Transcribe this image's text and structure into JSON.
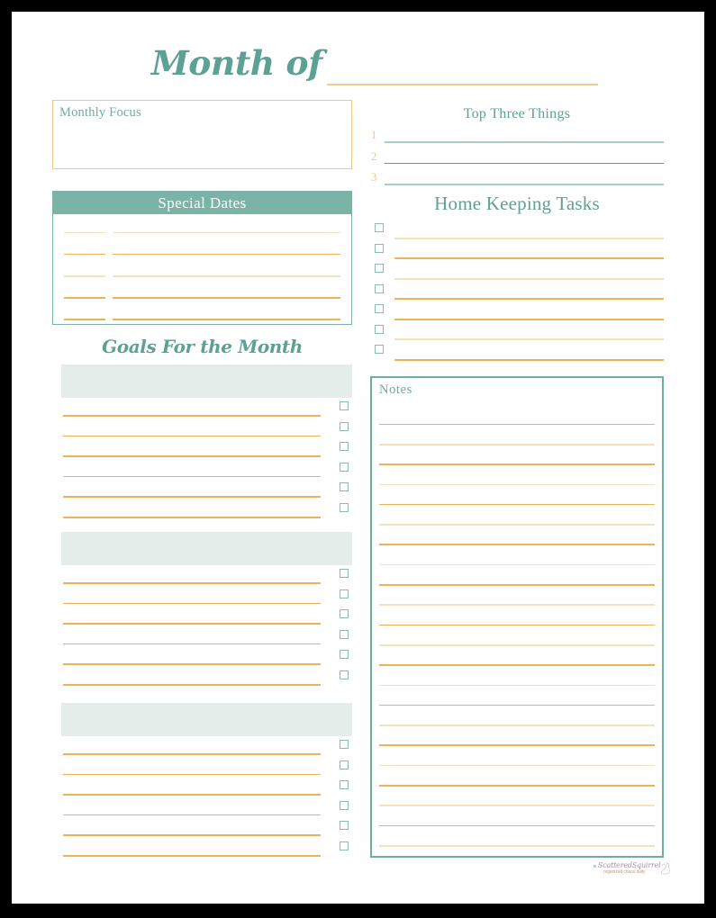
{
  "document": {
    "type": "monthly-planner-printable",
    "paper_background": "#ffffff",
    "frame_background": "#000000"
  },
  "theme": {
    "teal": "#7cb3a7",
    "teal_text": "#5fa095",
    "teal_soft": "#89bcb2",
    "gold_light": "#f7e0bb",
    "gold_dark": "#eeb25c",
    "gold_border": "#eec887",
    "band_gray": "#e5edeb",
    "line_teal_light": "#a8cdc6",
    "line_teal_dark": "#5ea095"
  },
  "masthead": {
    "title": "Month of",
    "rule_color": "#f1cd92"
  },
  "monthly_focus": {
    "label": "Monthly Focus",
    "border_color": "#eec887"
  },
  "top_three": {
    "title": "Top Three Things",
    "rows": [
      {
        "number": "1",
        "line_tone": "light"
      },
      {
        "number": "2",
        "line_tone": "dark"
      },
      {
        "number": "3",
        "line_tone": "light"
      }
    ]
  },
  "special_dates": {
    "title": "Special Dates",
    "header_bg": "#7cb3a7",
    "header_text_color": "#ffffff",
    "rows": [
      {
        "date_tone": "light",
        "text_tone": "light"
      },
      {
        "date_tone": "dark",
        "text_tone": "dark"
      },
      {
        "date_tone": "light",
        "text_tone": "light"
      },
      {
        "date_tone": "dark",
        "text_tone": "dark"
      },
      {
        "date_tone": "dark",
        "text_tone": "dark"
      }
    ]
  },
  "home_keeping": {
    "title": "Home Keeping Tasks",
    "rows": [
      {
        "checkbox": "unchecked",
        "line_tone": "light"
      },
      {
        "checkbox": "unchecked",
        "line_tone": "dark"
      },
      {
        "checkbox": "unchecked",
        "line_tone": "light"
      },
      {
        "checkbox": "unchecked",
        "line_tone": "dark"
      },
      {
        "checkbox": "unchecked",
        "line_tone": "dark"
      },
      {
        "checkbox": "unchecked",
        "line_tone": "light"
      },
      {
        "checkbox": "unchecked",
        "line_tone": "dark"
      }
    ]
  },
  "goals": {
    "title": "Goals For the Month",
    "blocks": [
      {
        "band_label": "",
        "rows": [
          {
            "checkbox": "unchecked",
            "line_tone": "dark"
          },
          {
            "checkbox": "unchecked",
            "line_tone": "dark"
          },
          {
            "checkbox": "unchecked",
            "line_tone": "dark"
          },
          {
            "checkbox": "unchecked",
            "line_tone": "dark"
          },
          {
            "checkbox": "unchecked",
            "line_tone": "dark"
          },
          {
            "checkbox": "unchecked",
            "line_tone": "dark"
          }
        ]
      },
      {
        "band_label": "",
        "rows": [
          {
            "checkbox": "unchecked",
            "line_tone": "dark"
          },
          {
            "checkbox": "unchecked",
            "line_tone": "dark"
          },
          {
            "checkbox": "unchecked",
            "line_tone": "dark"
          },
          {
            "checkbox": "unchecked",
            "line_tone": "dark"
          },
          {
            "checkbox": "unchecked",
            "line_tone": "dark"
          },
          {
            "checkbox": "unchecked",
            "line_tone": "dark"
          }
        ]
      },
      {
        "band_label": "",
        "rows": [
          {
            "checkbox": "unchecked",
            "line_tone": "dark"
          },
          {
            "checkbox": "unchecked",
            "line_tone": "dark"
          },
          {
            "checkbox": "unchecked",
            "line_tone": "dark"
          },
          {
            "checkbox": "unchecked",
            "line_tone": "dark"
          },
          {
            "checkbox": "unchecked",
            "line_tone": "dark"
          },
          {
            "checkbox": "unchecked",
            "line_tone": "dark"
          }
        ]
      }
    ]
  },
  "notes": {
    "label": "Notes",
    "border_color": "#6fae9f",
    "rows": [
      {
        "line_tone": "dark"
      },
      {
        "line_tone": "light"
      },
      {
        "line_tone": "dark"
      },
      {
        "line_tone": "light"
      },
      {
        "line_tone": "dark"
      },
      {
        "line_tone": "light"
      },
      {
        "line_tone": "dark"
      },
      {
        "line_tone": "light"
      },
      {
        "line_tone": "dark"
      },
      {
        "line_tone": "light"
      },
      {
        "line_tone": "dark"
      },
      {
        "line_tone": "light"
      },
      {
        "line_tone": "dark"
      },
      {
        "line_tone": "light"
      },
      {
        "line_tone": "dark"
      },
      {
        "line_tone": "light"
      },
      {
        "line_tone": "dark"
      },
      {
        "line_tone": "light"
      },
      {
        "line_tone": "dark"
      },
      {
        "line_tone": "light"
      },
      {
        "line_tone": "dark"
      },
      {
        "line_tone": "light"
      }
    ]
  },
  "footer": {
    "watermark_name": "ScatteredSquirrel",
    "watermark_tagline": "organized chaos daily"
  }
}
